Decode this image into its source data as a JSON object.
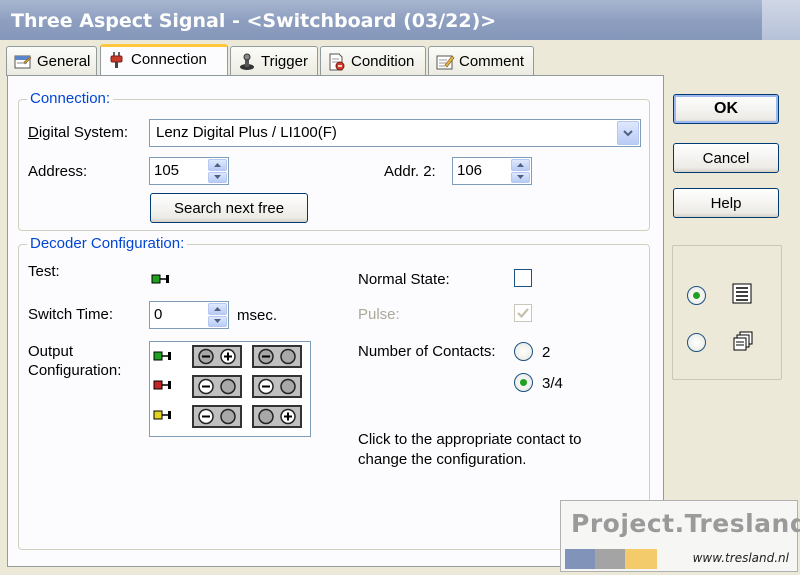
{
  "window": {
    "title": "Three Aspect Signal - <Switchboard (03/22)>"
  },
  "tabs": [
    {
      "label": "General",
      "icon": "general-icon"
    },
    {
      "label": "Connection",
      "icon": "plug-icon"
    },
    {
      "label": "Trigger",
      "icon": "trigger-icon"
    },
    {
      "label": "Condition",
      "icon": "condition-icon"
    },
    {
      "label": "Comment",
      "icon": "comment-icon"
    }
  ],
  "connection": {
    "group_title": "Connection:",
    "digital_system_label": "Digital System:",
    "digital_system_value": "Lenz Digital Plus / LI100(F)",
    "address_label": "Address:",
    "address_value": "105",
    "addr2_label": "Addr. 2:",
    "addr2_value": "106",
    "search_button": "Search next free"
  },
  "decoder": {
    "group_title": "Decoder Configuration:",
    "test_label": "Test:",
    "switch_time_label": "Switch Time:",
    "switch_time_value": "0",
    "switch_time_unit": "msec.",
    "output_label_line1": "Output",
    "output_label_line2": "Configuration:",
    "normal_state_label": "Normal State:",
    "normal_state_checked": false,
    "pulse_label": "Pulse:",
    "pulse_checked": true,
    "contacts_label": "Number of Contacts:",
    "contacts_options": [
      "2",
      "3/4"
    ],
    "contacts_selected": "3/4",
    "hint_line1": "Click to the appropriate contact to",
    "hint_line2": "change the configuration.",
    "rows": [
      {
        "led": "green",
        "left": [
          "minus",
          "plus"
        ],
        "right": [
          "minus",
          "off"
        ]
      },
      {
        "led": "red",
        "left": [
          "minus",
          "off"
        ],
        "right": [
          "minus",
          "off"
        ]
      },
      {
        "led": "yellow",
        "left": [
          "minus",
          "off"
        ],
        "right": [
          "off",
          "plus"
        ]
      }
    ]
  },
  "buttons": {
    "ok": "OK",
    "cancel": "Cancel",
    "help": "Help"
  },
  "view_options": {
    "selected": "list"
  },
  "watermark": {
    "title": "Project.Tresland",
    "url": "www.tresland.nl",
    "colors": [
      "#8193b8",
      "#a4a4a4",
      "#f3cb6a"
    ]
  },
  "colors": {
    "accent": "#0046d5",
    "tab_highlight": "#ffc83c",
    "led_green": "#1fa21f",
    "led_red": "#c42424",
    "led_yellow": "#e6d21a"
  }
}
